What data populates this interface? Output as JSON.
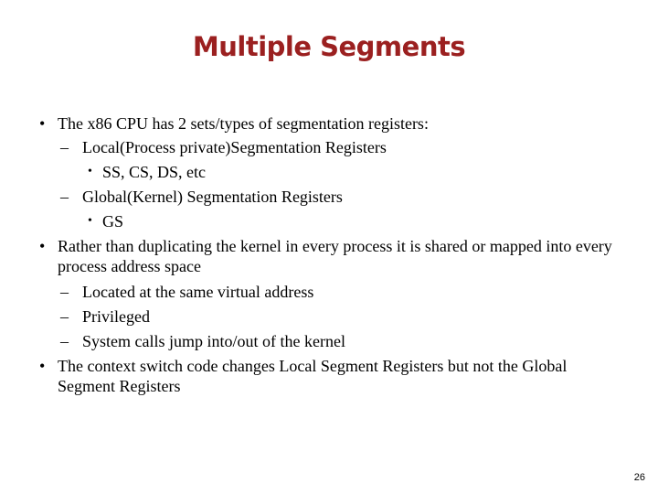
{
  "slide": {
    "title": "Multiple Segments",
    "page_number": "26"
  },
  "bullets": [
    {
      "marker": "•",
      "text": "The x86 CPU has 2 sets/types of segmentation registers:"
    },
    {
      "marker": "–",
      "text": "Local(Process private)Segmentation Registers"
    },
    {
      "marker": "•",
      "text": "SS, CS, DS, etc"
    },
    {
      "marker": "–",
      "text": "Global(Kernel) Segmentation Registers"
    },
    {
      "marker": "•",
      "text": "GS"
    },
    {
      "marker": "•",
      "text": "Rather than duplicating the kernel in every process it is shared or mapped into every process address space"
    },
    {
      "marker": "–",
      "text": "Located at the same virtual address"
    },
    {
      "marker": "–",
      "text": "Privileged"
    },
    {
      "marker": "–",
      "text": "System calls jump into/out of the kernel"
    },
    {
      "marker": "•",
      "text": "The context switch code changes Local Segment Registers but not the Global Segment Registers"
    }
  ]
}
